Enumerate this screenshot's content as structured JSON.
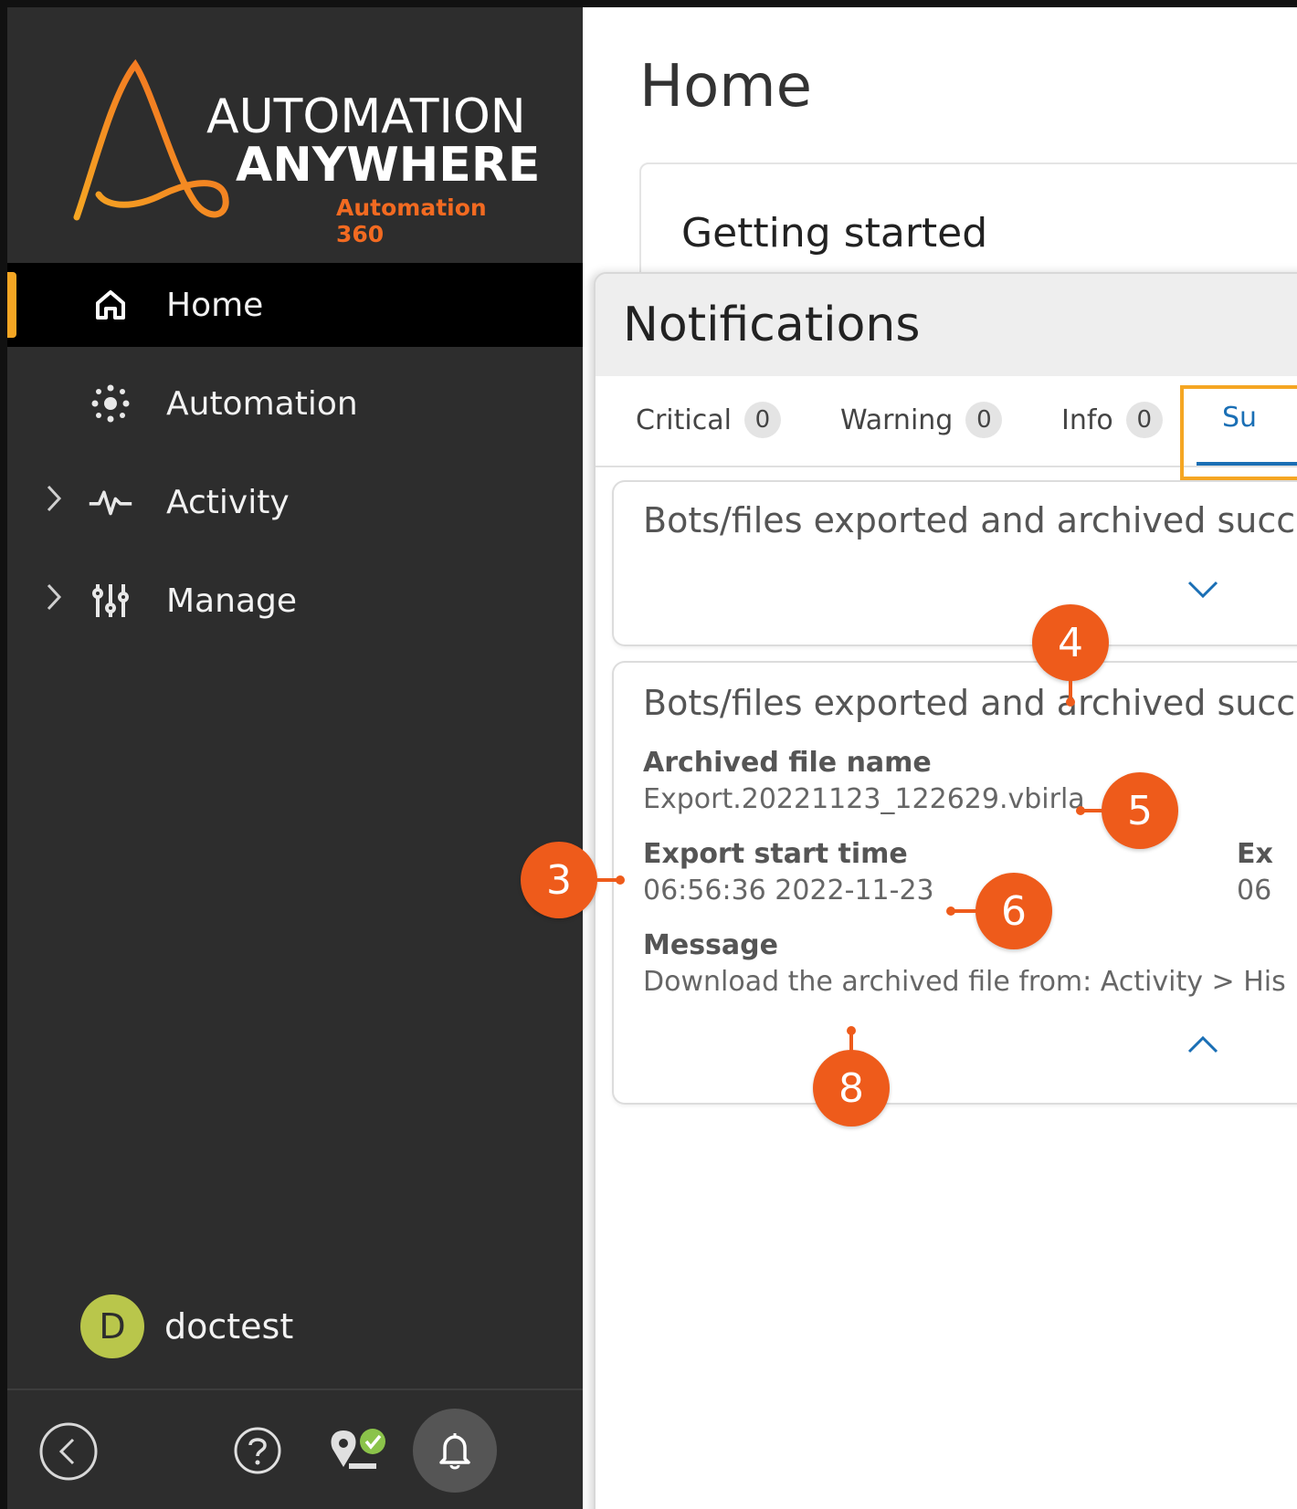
{
  "logo": {
    "line1": "AUTOMATION",
    "line2": "ANYWHERE",
    "line3": "Automation 360"
  },
  "nav": {
    "items": [
      {
        "label": "Home",
        "icon": "home-icon"
      },
      {
        "label": "Automation",
        "icon": "automation-icon"
      },
      {
        "label": "Activity",
        "icon": "activity-icon"
      },
      {
        "label": "Manage",
        "icon": "manage-sliders-icon"
      }
    ]
  },
  "user": {
    "initial": "D",
    "name": "doctest"
  },
  "main": {
    "title": "Home",
    "getting_started": "Getting started"
  },
  "notifications": {
    "title": "Notifications",
    "tabs": [
      {
        "label": "Critical",
        "count": "0"
      },
      {
        "label": "Warning",
        "count": "0"
      },
      {
        "label": "Info",
        "count": "0"
      },
      {
        "label": "Su"
      }
    ],
    "cards": [
      {
        "title": "Bots/files exported and archived succes"
      },
      {
        "title": "Bots/files exported and archived succes",
        "archived_label": "Archived file name",
        "archived_value": "Export.20221123_122629.vbirla",
        "start_label": "Export start time",
        "start_value": "06:56:36 2022-11-23",
        "end_label": "Ex",
        "end_value": "06",
        "message_label": "Message",
        "message_value": "Download the archived file from: Activity > His"
      }
    ]
  },
  "callouts": [
    "3",
    "4",
    "5",
    "6",
    "8"
  ],
  "colors": {
    "sidebar": "#2d2d2d",
    "accent_orange": "#ee5b1b",
    "highlight": "#f5a623",
    "tab_selected": "#1a6fb5"
  }
}
